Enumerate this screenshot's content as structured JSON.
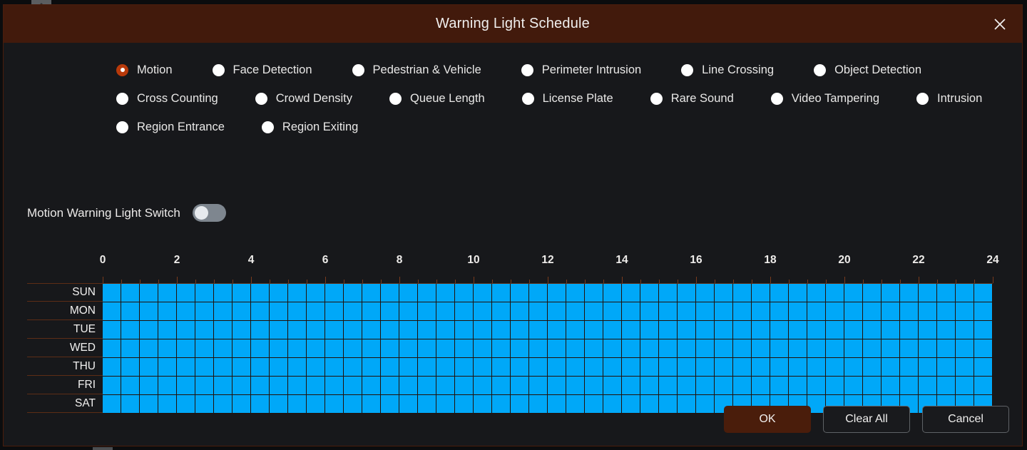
{
  "dialog": {
    "title": "Warning Light Schedule",
    "close_icon": "close-icon"
  },
  "event_types": {
    "selected": "Motion",
    "rows": [
      [
        {
          "label": "Motion",
          "selected": true
        },
        {
          "label": "Face Detection",
          "selected": false
        },
        {
          "label": "Pedestrian & Vehicle",
          "selected": false
        },
        {
          "label": "Perimeter Intrusion",
          "selected": false
        },
        {
          "label": "Line Crossing",
          "selected": false
        },
        {
          "label": "Object Detection",
          "selected": false
        }
      ],
      [
        {
          "label": "Cross Counting",
          "selected": false
        },
        {
          "label": "Crowd Density",
          "selected": false
        },
        {
          "label": "Queue Length",
          "selected": false
        },
        {
          "label": "License Plate",
          "selected": false
        },
        {
          "label": "Rare Sound",
          "selected": false
        },
        {
          "label": "Video Tampering",
          "selected": false
        },
        {
          "label": "Intrusion",
          "selected": false
        }
      ],
      [
        {
          "label": "Region Entrance",
          "selected": false
        },
        {
          "label": "Region Exiting",
          "selected": false
        }
      ]
    ]
  },
  "switch": {
    "label": "Motion Warning Light Switch",
    "on": false
  },
  "schedule": {
    "hour_labels": [
      "0",
      "2",
      "4",
      "6",
      "8",
      "10",
      "12",
      "14",
      "16",
      "18",
      "20",
      "22",
      "24"
    ],
    "days": [
      "SUN",
      "MON",
      "TUE",
      "WED",
      "THU",
      "FRI",
      "SAT"
    ],
    "slots_per_day": 48,
    "slot_minutes": 30,
    "selected_all": true,
    "cell_color": "#00a8f8",
    "grid": [
      [
        1,
        1,
        1,
        1,
        1,
        1,
        1,
        1,
        1,
        1,
        1,
        1,
        1,
        1,
        1,
        1,
        1,
        1,
        1,
        1,
        1,
        1,
        1,
        1,
        1,
        1,
        1,
        1,
        1,
        1,
        1,
        1,
        1,
        1,
        1,
        1,
        1,
        1,
        1,
        1,
        1,
        1,
        1,
        1,
        1,
        1,
        1,
        1
      ],
      [
        1,
        1,
        1,
        1,
        1,
        1,
        1,
        1,
        1,
        1,
        1,
        1,
        1,
        1,
        1,
        1,
        1,
        1,
        1,
        1,
        1,
        1,
        1,
        1,
        1,
        1,
        1,
        1,
        1,
        1,
        1,
        1,
        1,
        1,
        1,
        1,
        1,
        1,
        1,
        1,
        1,
        1,
        1,
        1,
        1,
        1,
        1,
        1
      ],
      [
        1,
        1,
        1,
        1,
        1,
        1,
        1,
        1,
        1,
        1,
        1,
        1,
        1,
        1,
        1,
        1,
        1,
        1,
        1,
        1,
        1,
        1,
        1,
        1,
        1,
        1,
        1,
        1,
        1,
        1,
        1,
        1,
        1,
        1,
        1,
        1,
        1,
        1,
        1,
        1,
        1,
        1,
        1,
        1,
        1,
        1,
        1,
        1
      ],
      [
        1,
        1,
        1,
        1,
        1,
        1,
        1,
        1,
        1,
        1,
        1,
        1,
        1,
        1,
        1,
        1,
        1,
        1,
        1,
        1,
        1,
        1,
        1,
        1,
        1,
        1,
        1,
        1,
        1,
        1,
        1,
        1,
        1,
        1,
        1,
        1,
        1,
        1,
        1,
        1,
        1,
        1,
        1,
        1,
        1,
        1,
        1,
        1
      ],
      [
        1,
        1,
        1,
        1,
        1,
        1,
        1,
        1,
        1,
        1,
        1,
        1,
        1,
        1,
        1,
        1,
        1,
        1,
        1,
        1,
        1,
        1,
        1,
        1,
        1,
        1,
        1,
        1,
        1,
        1,
        1,
        1,
        1,
        1,
        1,
        1,
        1,
        1,
        1,
        1,
        1,
        1,
        1,
        1,
        1,
        1,
        1,
        1
      ],
      [
        1,
        1,
        1,
        1,
        1,
        1,
        1,
        1,
        1,
        1,
        1,
        1,
        1,
        1,
        1,
        1,
        1,
        1,
        1,
        1,
        1,
        1,
        1,
        1,
        1,
        1,
        1,
        1,
        1,
        1,
        1,
        1,
        1,
        1,
        1,
        1,
        1,
        1,
        1,
        1,
        1,
        1,
        1,
        1,
        1,
        1,
        1,
        1
      ],
      [
        1,
        1,
        1,
        1,
        1,
        1,
        1,
        1,
        1,
        1,
        1,
        1,
        1,
        1,
        1,
        1,
        1,
        1,
        1,
        1,
        1,
        1,
        1,
        1,
        1,
        1,
        1,
        1,
        1,
        1,
        1,
        1,
        1,
        1,
        1,
        1,
        1,
        1,
        1,
        1,
        1,
        1,
        1,
        1,
        1,
        1,
        1,
        1
      ]
    ]
  },
  "buttons": {
    "ok": "OK",
    "clear_all": "Clear All",
    "cancel": "Cancel"
  },
  "colors": {
    "title_bar": "#421a0c",
    "dialog_bg": "#17181b",
    "accent": "#b8390a",
    "cell_on": "#00a8f8",
    "grid_line": "#241008",
    "row_line": "#5d2d16"
  }
}
